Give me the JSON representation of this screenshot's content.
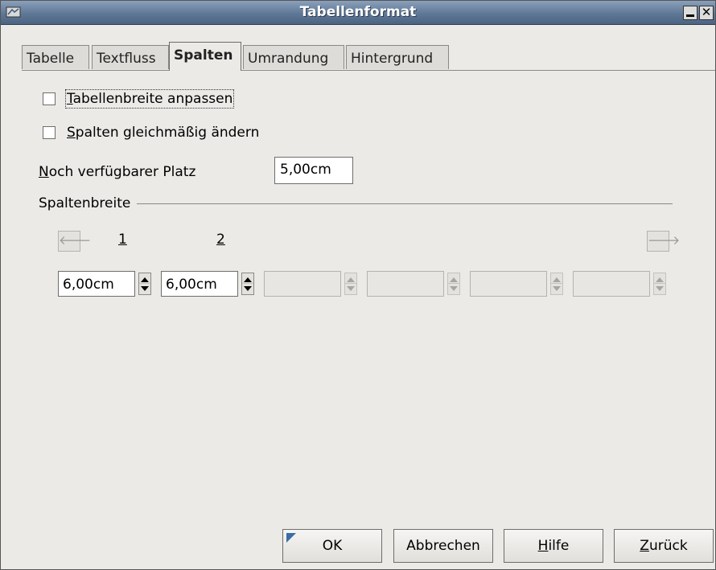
{
  "window": {
    "title": "Tabellenformat"
  },
  "tabs": [
    "Tabelle",
    "Textfluss",
    "Spalten",
    "Umrandung",
    "Hintergrund"
  ],
  "active_tab": "Spalten",
  "options": {
    "adapt_width_label": "Tabellenbreite anpassen",
    "adjust_columns_label": "Spalten gleichmäßig ändern"
  },
  "remaining_space": {
    "label": "Noch verfügbarer Platz",
    "value": "5,00cm"
  },
  "column_width": {
    "group_label": "Spaltenbreite",
    "column_numbers": [
      "1",
      "2"
    ],
    "values": [
      "6,00cm",
      "6,00cm",
      "",
      "",
      "",
      ""
    ]
  },
  "buttons": {
    "ok": "OK",
    "cancel": "Abbrechen",
    "help": "Hilfe",
    "back": "Zurück"
  },
  "icons": {
    "app": "window-icon",
    "prev": "arrow-left-icon",
    "next": "arrow-right-icon"
  },
  "colors": {
    "titlebar": "#5f7896",
    "dialog_bg": "#ebeae7",
    "default_marker": "#3a6ea5"
  }
}
